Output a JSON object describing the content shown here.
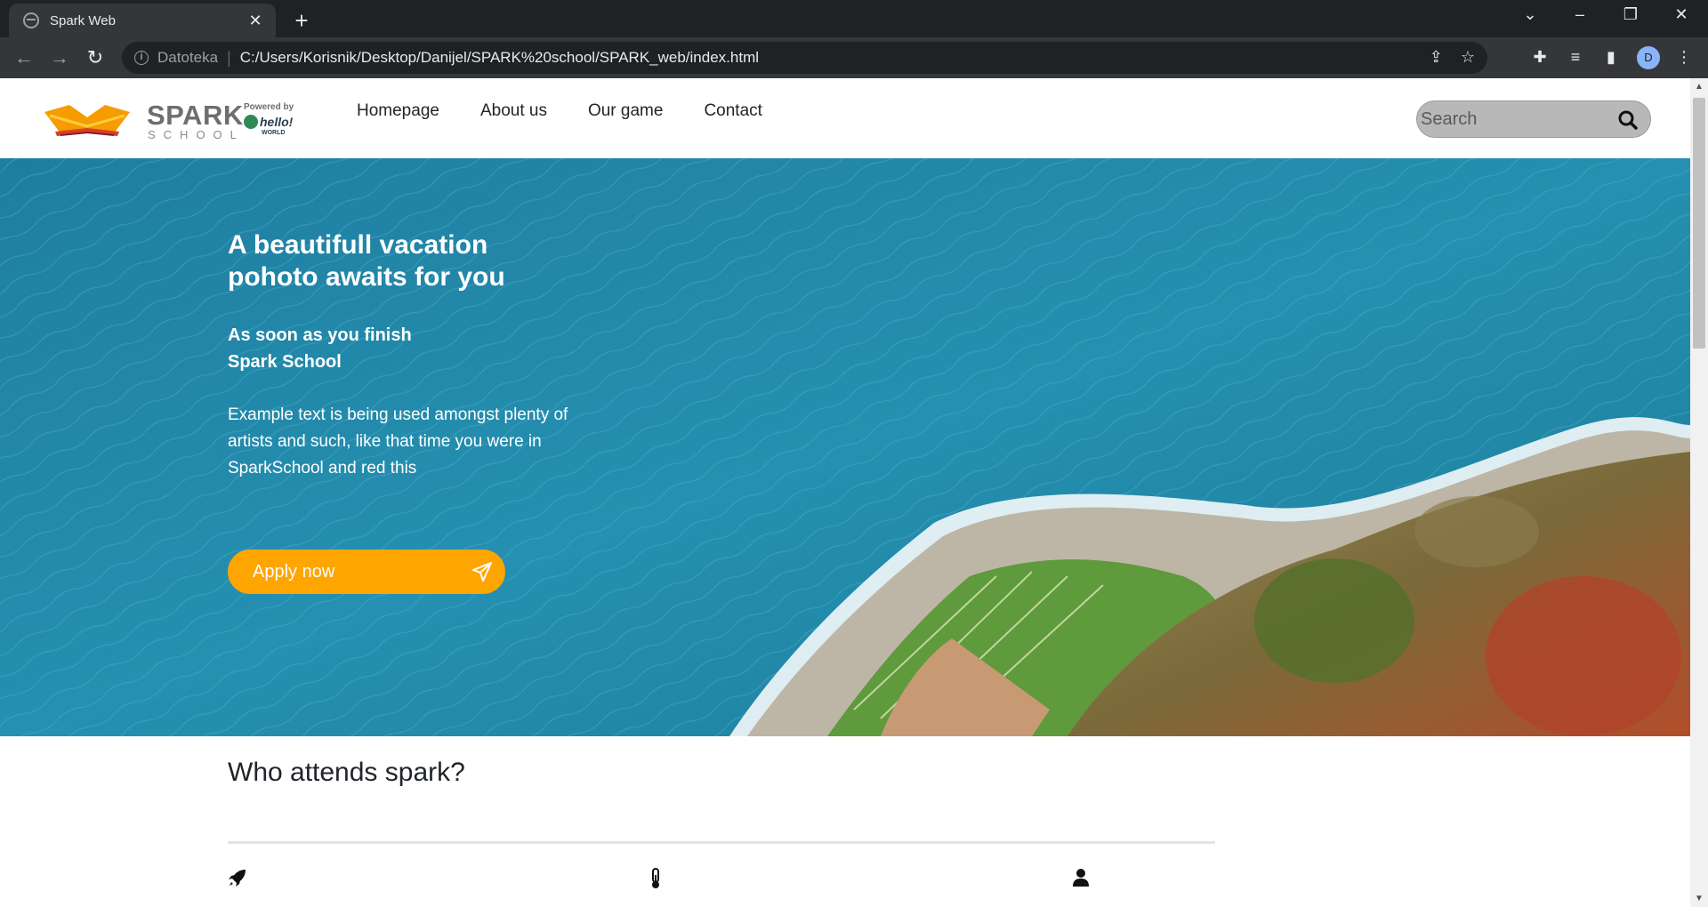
{
  "browser": {
    "tab_title": "Spark Web",
    "tab_close": "✕",
    "new_tab": "+",
    "scheme_label": "Datoteka",
    "url": "C:/Users/Korisnik/Desktop/Danijel/SPARK%20school/SPARK_web/index.html",
    "profile_initial": "D"
  },
  "logo": {
    "brand": "SPARK",
    "dot": ".",
    "sub": "SCHOOL",
    "powered_by": "Powered by",
    "partner": "hello!",
    "partner_sub": "WORLD"
  },
  "nav": {
    "items": [
      "Homepage",
      "About us",
      "Our game",
      "Contact"
    ]
  },
  "search": {
    "placeholder": "Search"
  },
  "hero": {
    "title": "A beautifull vacation pohoto awaits for you",
    "subtitle_line1": "As soon as you finish",
    "subtitle_line2": "Spark School",
    "body": "Example text is being used amongst plenty of artists and such, like that time you were in SparkSchool and red this",
    "button_label": "Apply now"
  },
  "section": {
    "title": "Who attends spark?",
    "features": [
      {
        "icon": "rocket-icon"
      },
      {
        "icon": "thermometer-icon"
      },
      {
        "icon": "user-icon"
      }
    ]
  },
  "colors": {
    "accent": "#ffa500",
    "sea": "#1f86a8",
    "nav_text": "#212529"
  }
}
